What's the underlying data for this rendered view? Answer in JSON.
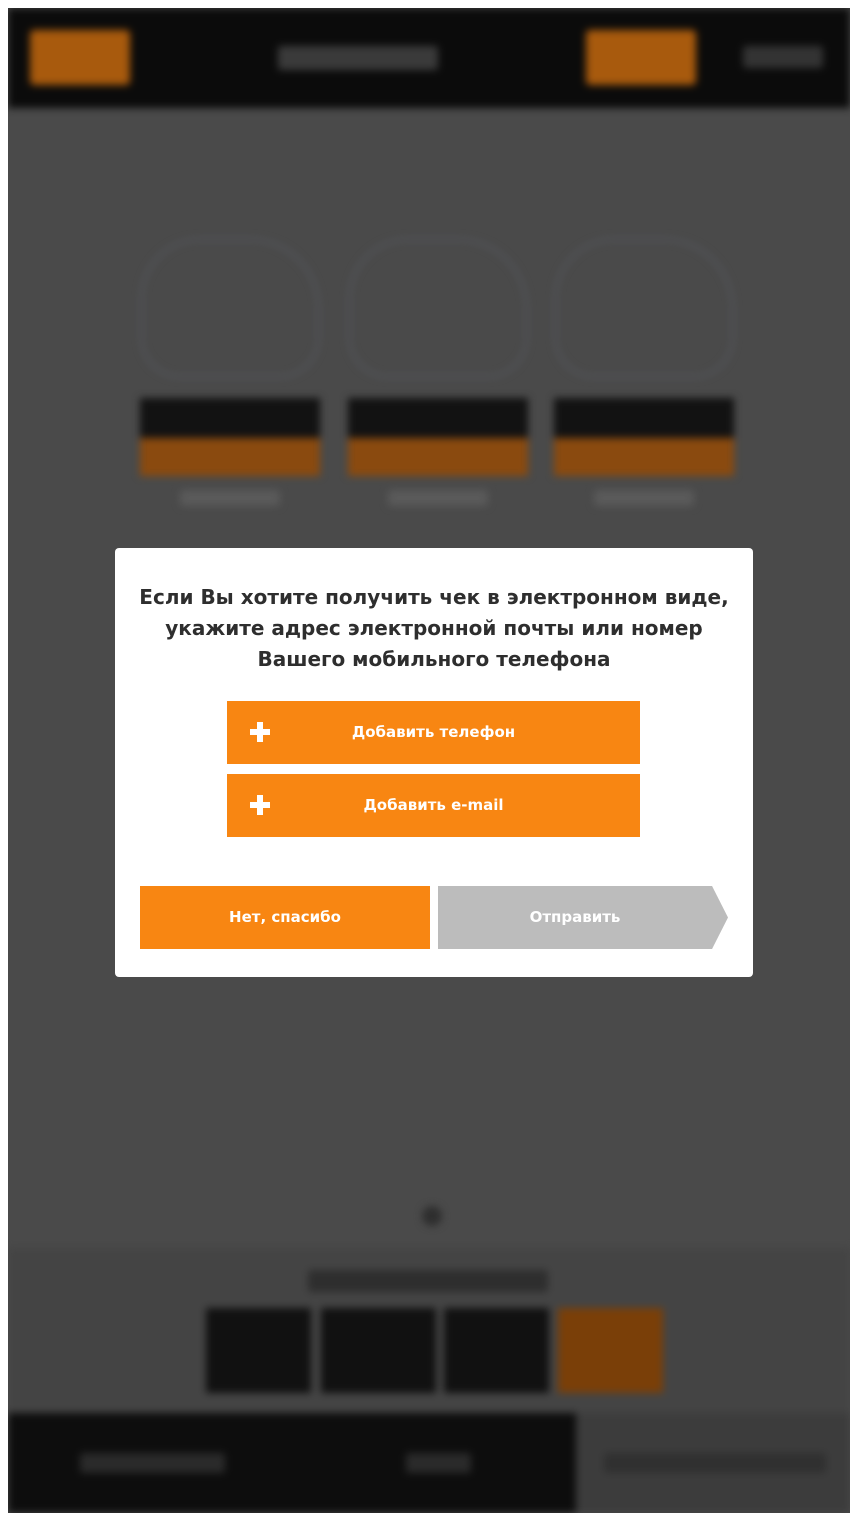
{
  "dialog": {
    "message": "Если Вы хотите получить чек в электронном виде, укажите адрес электронной почты или номер Вашего мобильного телефона",
    "add_phone_label": "Добавить телефон",
    "add_email_label": "Добавить e-mail",
    "decline_label": "Нет, спасибо",
    "send_label": "Отправить"
  },
  "icons": {
    "add_phone": "plus-icon",
    "add_email": "plus-icon",
    "send": "arrow-shaped-button"
  },
  "colors": {
    "accent": "#f88612",
    "disabled": "#bcbcbc",
    "overlay": "#4a4a4a",
    "dialog_bg": "#ffffff",
    "text": "#2e2e2e"
  }
}
